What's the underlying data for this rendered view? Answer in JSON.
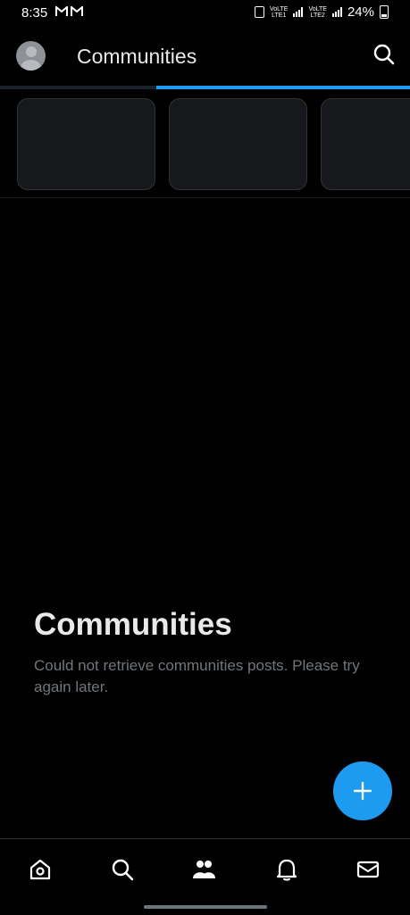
{
  "status_bar": {
    "time": "8:35",
    "battery": "24%",
    "sim1": "LTE1",
    "sim2": "LTE2",
    "volte": "VoLTE"
  },
  "header": {
    "title": "Communities"
  },
  "empty_state": {
    "title": "Communities",
    "message": "Could not retrieve communities posts. Please try again later."
  },
  "colors": {
    "accent": "#1d9bf0",
    "background": "#000000",
    "card": "#16181c",
    "muted_text": "#71767b"
  },
  "icons": {
    "nav": [
      "home-icon",
      "search-icon",
      "communities-icon",
      "notifications-icon",
      "messages-icon"
    ],
    "fab": "plus-icon",
    "header_right": "search-icon"
  },
  "loading_progress_percent": 62
}
